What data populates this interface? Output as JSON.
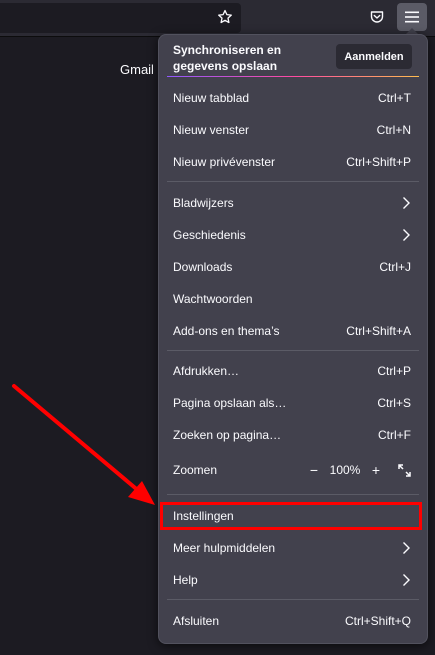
{
  "toolbar": {
    "star_icon": "star-icon",
    "pocket_icon": "pocket-icon",
    "menu_icon": "hamburger-menu-icon"
  },
  "page": {
    "gmail_link": "Gmail"
  },
  "menu": {
    "sync_label": "Synchroniseren en gegevens opslaan",
    "sync_line1": "Synchroniseren en",
    "sync_line2": "gegevens opslaan",
    "signin_button": "Aanmelden",
    "new_tab": "Nieuw tabblad",
    "new_tab_shortcut": "Ctrl+T",
    "new_window": "Nieuw venster",
    "new_window_shortcut": "Ctrl+N",
    "new_private_window": "Nieuw privévenster",
    "new_private_window_shortcut": "Ctrl+Shift+P",
    "bookmarks": "Bladwijzers",
    "history": "Geschiedenis",
    "downloads": "Downloads",
    "downloads_shortcut": "Ctrl+J",
    "passwords": "Wachtwoorden",
    "addons": "Add-ons en thema’s",
    "addons_shortcut": "Ctrl+Shift+A",
    "print": "Afdrukken…",
    "print_shortcut": "Ctrl+P",
    "save_page": "Pagina opslaan als…",
    "save_page_shortcut": "Ctrl+S",
    "find": "Zoeken op pagina…",
    "find_shortcut": "Ctrl+F",
    "zoom": "Zoomen",
    "zoom_out": "−",
    "zoom_value": "100%",
    "zoom_in": "+",
    "settings": "Instellingen",
    "more_tools": "Meer hulpmiddelen",
    "help": "Help",
    "quit": "Afsluiten",
    "quit_shortcut": "Ctrl+Shift+Q"
  },
  "annotation": {
    "highlight_color": "#ff0000",
    "arrow_color": "#ff0000"
  }
}
